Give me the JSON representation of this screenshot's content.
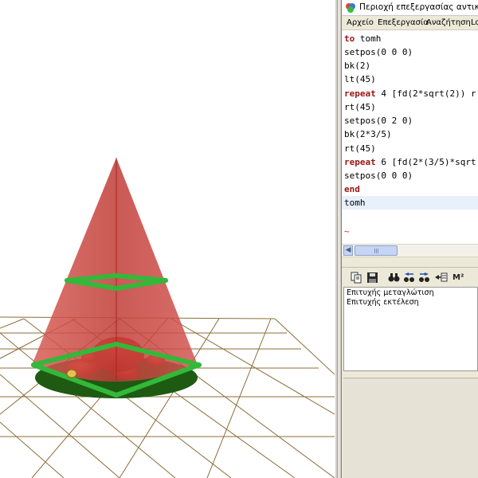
{
  "window": {
    "title": "Περιοχή επεξεργασίας αντικειμένων"
  },
  "menu": {
    "items": [
      "Αρχείο",
      "Επεξεργασία",
      "Αναζήτηση",
      "Lo"
    ]
  },
  "editor": {
    "lines": [
      {
        "kw": "to",
        "rest": " tomh"
      },
      {
        "kw": "",
        "rest": "setpos(0 0 0)"
      },
      {
        "kw": "",
        "rest": "bk(2)"
      },
      {
        "kw": "",
        "rest": "lt(45)"
      },
      {
        "kw": "repeat",
        "rest": " 4 [fd(2*sqrt(2)) r"
      },
      {
        "kw": "",
        "rest": "rt(45)"
      },
      {
        "kw": "",
        "rest": "setpos(0 2 0)"
      },
      {
        "kw": "",
        "rest": "bk(2*3/5)"
      },
      {
        "kw": "",
        "rest": "rt(45)"
      },
      {
        "kw": "repeat",
        "rest": " 6 [fd(2*(3/5)*sqrt"
      },
      {
        "kw": "",
        "rest": "setpos(0 0 0)"
      },
      {
        "kw": "end",
        "rest": ""
      },
      {
        "kw": "",
        "rest": "tomh"
      }
    ],
    "tilde": "~",
    "highlighted_line": 12
  },
  "output": {
    "lines": [
      "Επιτυχής μεταγλώτιση",
      "Επιτυχής εκτέλεση"
    ]
  },
  "toolbar": {
    "icons": [
      "copy-icon",
      "save-icon",
      "find-icon",
      "find-previous-icon",
      "find-next-icon",
      "insert-icon",
      "memory-icon"
    ],
    "memory_label": "M²"
  },
  "colors": {
    "cone": "#c23a36",
    "cone_base": "#1f5a12",
    "square_edges": "#33b83a",
    "grid": "#8c6d3a",
    "keyword": "#9a1414"
  }
}
